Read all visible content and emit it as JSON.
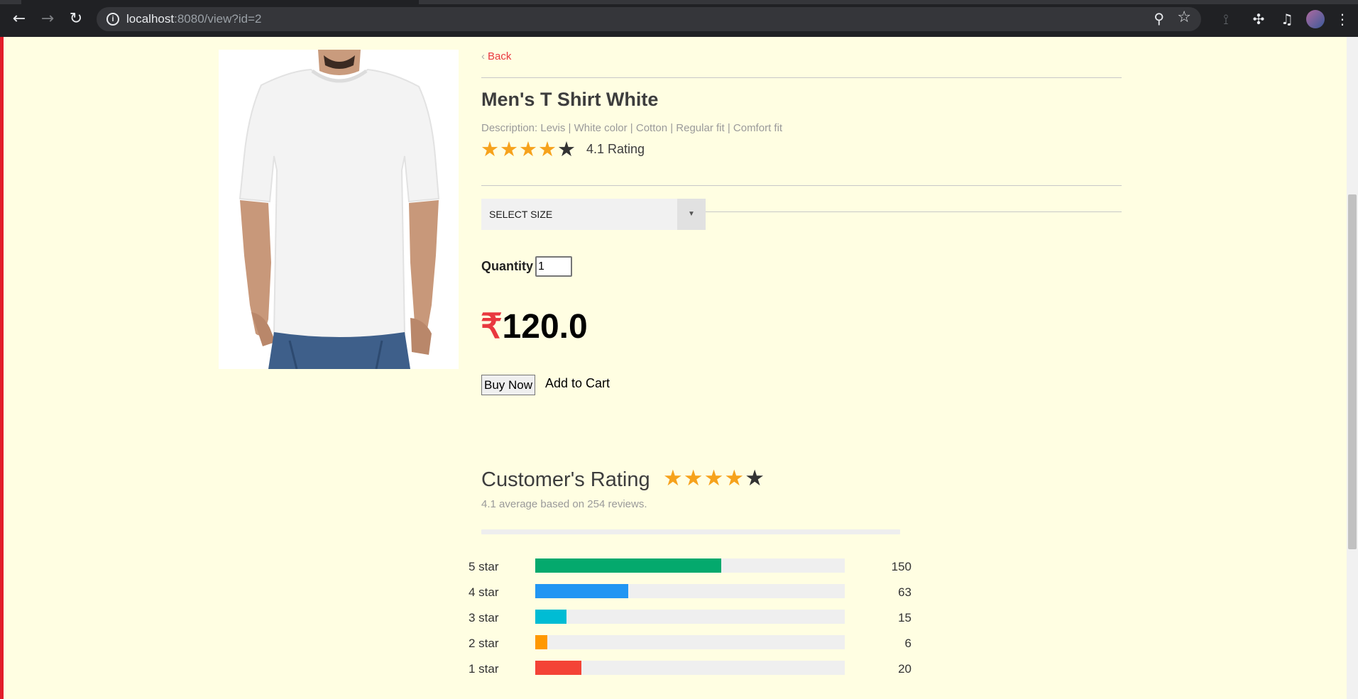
{
  "browser": {
    "url_host": "localhost",
    "url_rest": ":8080/view?id=2"
  },
  "product": {
    "back_label": "Back",
    "title": "Men's T Shirt White",
    "description": "Description: Levis | White color | Cotton | Regular fit | Comfort fit",
    "rating_text": "4.1 Rating",
    "stars_filled": 4,
    "stars_total": 5,
    "select_size_label": "SELECT SIZE",
    "quantity_label": "Quantity",
    "quantity_value": "1",
    "currency_symbol": "₹",
    "price": "120.0",
    "buy_label": "Buy Now",
    "cart_label": "Add to Cart"
  },
  "customer_rating": {
    "title": "Customer's Rating",
    "summary": "4.1 average based on 254 reviews.",
    "stars_filled": 4,
    "rows": [
      {
        "label": "5 star",
        "count": "150",
        "fraction": 0.6,
        "color": "#04a96d"
      },
      {
        "label": "4 star",
        "count": "63",
        "fraction": 0.3,
        "color": "#2196f3"
      },
      {
        "label": "3 star",
        "count": "15",
        "fraction": 0.1,
        "color": "#00bcd4"
      },
      {
        "label": "2 star",
        "count": "6",
        "fraction": 0.04,
        "color": "#ff9800"
      },
      {
        "label": "1 star",
        "count": "20",
        "fraction": 0.15,
        "color": "#f44336"
      }
    ]
  },
  "colors": {
    "page_bg": "#fffee2",
    "accent_red": "#e9383f",
    "star_on": "#f6a21c",
    "star_off": "#333333"
  }
}
